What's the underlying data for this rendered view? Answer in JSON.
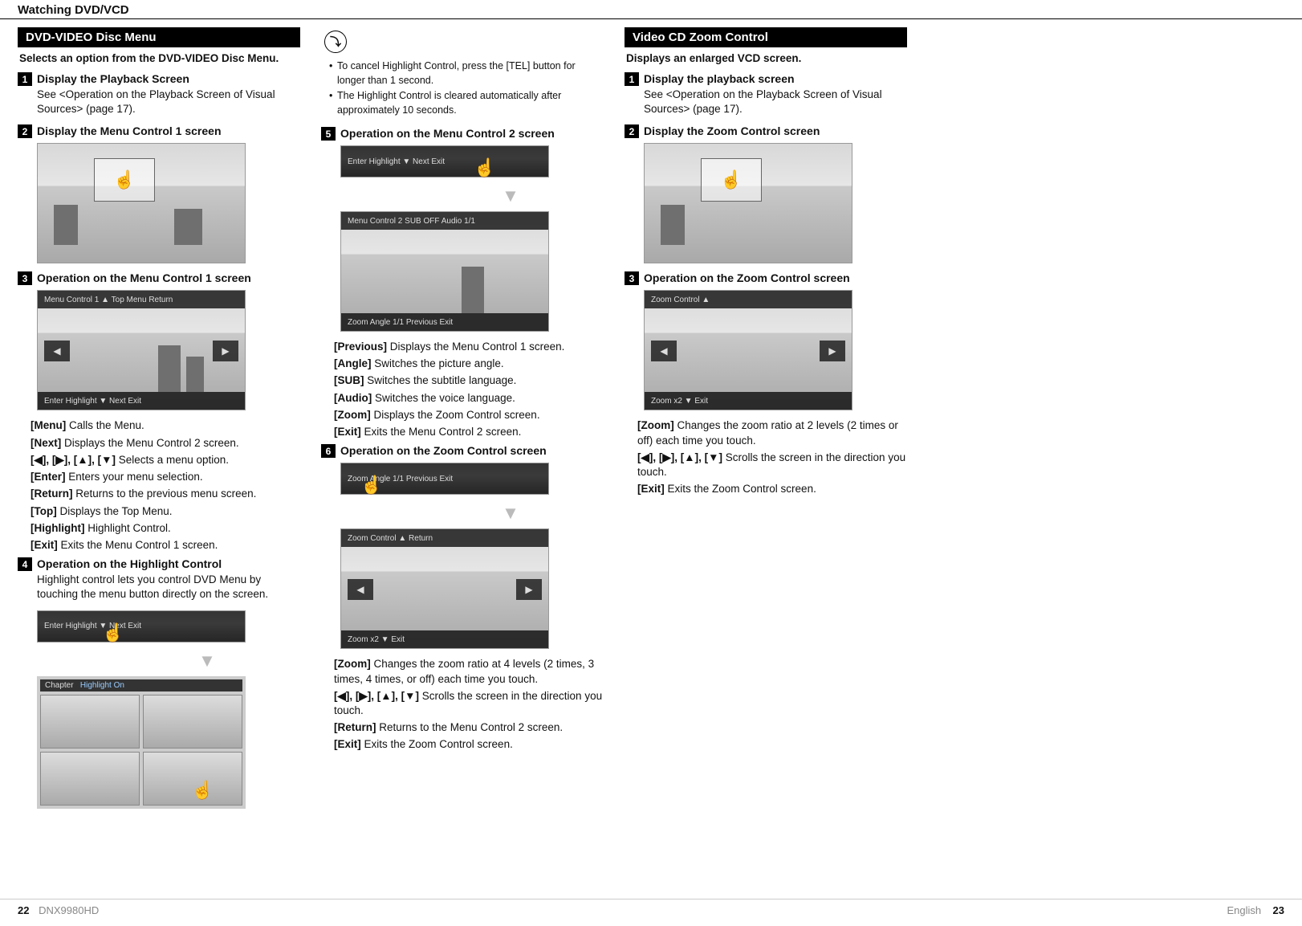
{
  "header": {
    "title": "Watching DVD/VCD"
  },
  "col1": {
    "section_title": "DVD-VIDEO Disc Menu",
    "intro": "Selects an option from the DVD-VIDEO Disc Menu.",
    "s1_num": "1",
    "s1_title": "Display the Playback Screen",
    "s1_desc": "See <Operation on the Playback Screen of Visual Sources> (page 17).",
    "s2_num": "2",
    "s2_title": "Display the Menu Control 1 screen",
    "s3_num": "3",
    "s3_title": "Operation on the Menu Control 1 screen",
    "mc1_top_labels": "Menu Control 1    ▲   Top   Menu   Return",
    "mc1_bot_labels": "Enter   Highlight   ▼       Next       Exit",
    "d_menu_l": "[Menu]",
    "d_menu_t": "  Calls the Menu.",
    "d_next_l": "[Next]",
    "d_next_t": "  Displays the Menu Control 2 screen.",
    "d_arrows_l": "[◀], [▶], [▲], [▼]",
    "d_arrows_t": "  Selects a menu option.",
    "d_enter_l": "[Enter]",
    "d_enter_t": "  Enters your menu selection.",
    "d_return_l": "[Return]",
    "d_return_t": "  Returns to the previous menu screen.",
    "d_top_l": "[Top]",
    "d_top_t": "  Displays the Top Menu.",
    "d_high_l": "[Highlight]",
    "d_high_t": "  Highlight Control.",
    "d_exit_l": "[Exit]",
    "d_exit_t": "  Exits the Menu Control 1 screen.",
    "s4_num": "4",
    "s4_title": "Operation on the Highlight Control",
    "s4_desc": "Highlight control lets you control DVD Menu by touching the menu button directly on the screen.",
    "chapter_label": "Chapter",
    "highlight_on": "Highlight On"
  },
  "col2": {
    "note1": "To cancel Highlight Control, press the [TEL] button for longer than 1 second.",
    "note2": "The Highlight Control is cleared automatically after approximately 10 seconds.",
    "s5_num": "5",
    "s5_title": "Operation on the Menu Control 2 screen",
    "bar5_labels": "Enter   Highlight   ▼       Next       Exit",
    "mc2_top_labels": "Menu Control 2       SUB   OFF   Audio   1/1",
    "mc2_bot_labels": "Zoom      Angle 1/1     Previous     Exit",
    "d_prev_l": "[Previous]",
    "d_prev_t": "  Displays the Menu Control 1 screen.",
    "d_angle_l": "[Angle]",
    "d_angle_t": "  Switches the picture angle.",
    "d_sub_l": "[SUB]",
    "d_sub_t": "  Switches the subtitle language.",
    "d_audio_l": "[Audio]",
    "d_audio_t": "  Switches the voice language.",
    "d_zoom_l": "[Zoom]",
    "d_zoom_t": "  Displays the Zoom Control screen.",
    "d_exit2_l": "[Exit]",
    "d_exit2_t": "  Exits the Menu Control 2 screen.",
    "s6_num": "6",
    "s6_title": "Operation on the Zoom Control screen",
    "bar6_labels": "Zoom      Angle 1/1     Previous     Exit",
    "zc_top_labels": "Zoom Control       ▲                    Return",
    "zc_bot_labels": "Zoom   x2        ▼                 Exit",
    "d_z_zoom_l": "[Zoom]",
    "d_z_zoom_t": "  Changes the zoom ratio at 4 levels (2 times, 3 times, 4 times, or off) each time you touch.",
    "d_z_arr_l": "[◀], [▶], [▲], [▼]",
    "d_z_arr_t": "  Scrolls the screen in the direction you touch.",
    "d_z_ret_l": "[Return]",
    "d_z_ret_t": "  Returns to the Menu Control 2 screen.",
    "d_z_exit_l": "[Exit]",
    "d_z_exit_t": "  Exits the Zoom Control screen."
  },
  "col3": {
    "section_title": "Video CD Zoom Control",
    "intro": "Displays an enlarged VCD screen.",
    "s1_num": "1",
    "s1_title": "Display the playback screen",
    "s1_desc": "See <Operation on the Playback Screen of Visual Sources> (page 17).",
    "s2_num": "2",
    "s2_title": "Display the Zoom Control screen",
    "s3_num": "3",
    "s3_title": "Operation on the Zoom Control screen",
    "vzc_top_labels": "Zoom Control       ▲",
    "vzc_bot_labels": "Zoom   x2        ▼                 Exit",
    "d_v_zoom_l": "[Zoom]",
    "d_v_zoom_t": "  Changes the zoom ratio at 2 levels (2 times or off) each time you touch.",
    "d_v_arr_l": "[◀], [▶], [▲], [▼]",
    "d_v_arr_t": "  Scrolls the screen in the direction you touch.",
    "d_v_exit_l": "[Exit]",
    "d_v_exit_t": "  Exits the Zoom Control screen."
  },
  "footer": {
    "left_page": "22",
    "model": "DNX9980HD",
    "right_lang": "English",
    "right_page": "23"
  },
  "glyphs": {
    "hand": "☝",
    "note": "⤵",
    "left": "◀",
    "right": "▶",
    "down": "▼"
  }
}
